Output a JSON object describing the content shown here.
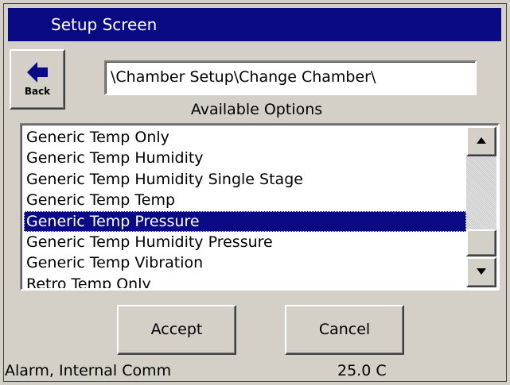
{
  "window": {
    "title": "Setup Screen"
  },
  "toolbar": {
    "back_label": "Back"
  },
  "path": {
    "value": "\\Chamber Setup\\Change Chamber\\"
  },
  "options": {
    "label": "Available Options",
    "items": [
      {
        "label": "Generic Temp Only",
        "selected": false
      },
      {
        "label": "Generic Temp Humidity",
        "selected": false
      },
      {
        "label": "Generic Temp Humidity Single Stage",
        "selected": false
      },
      {
        "label": "Generic Temp Temp",
        "selected": false
      },
      {
        "label": "Generic Temp Pressure",
        "selected": true
      },
      {
        "label": "Generic Temp Humidity Pressure",
        "selected": false
      },
      {
        "label": "Generic Temp Vibration",
        "selected": false
      },
      {
        "label": "Retro Temp Only",
        "selected": false
      }
    ]
  },
  "actions": {
    "accept_label": "Accept",
    "cancel_label": "Cancel"
  },
  "status": {
    "message": "Alarm, Internal Comm",
    "temperature": "25.0 C"
  },
  "colors": {
    "titlebar": "#0a0a84",
    "selection": "#0a0a84",
    "background": "#d4d0c8"
  },
  "icons": {
    "back": "left-arrow-icon",
    "scroll_up": "triangle-up-icon",
    "scroll_down": "triangle-down-icon"
  }
}
